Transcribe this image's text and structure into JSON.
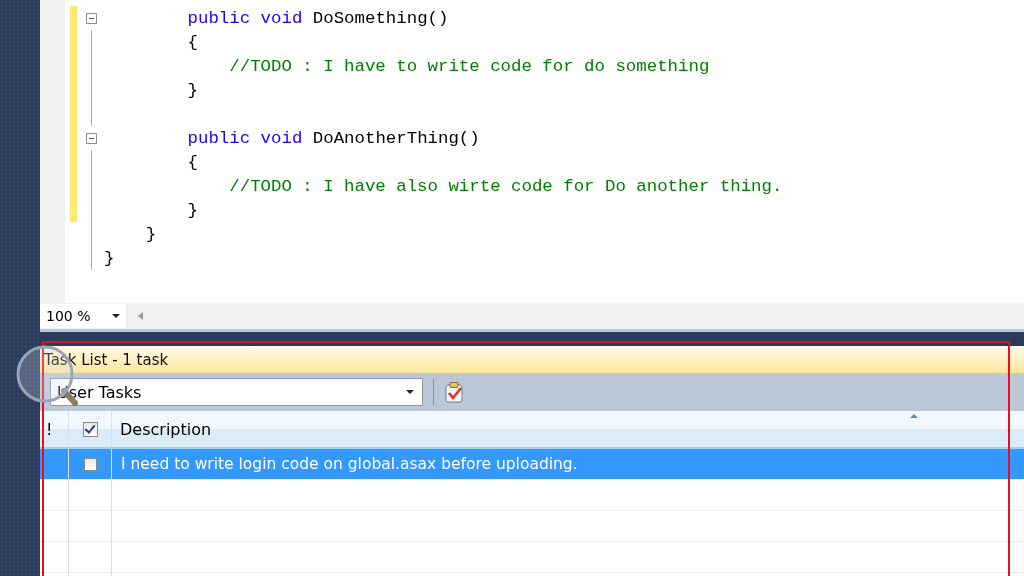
{
  "editor": {
    "code": [
      {
        "kind": "group",
        "children": [
          {
            "kind": "group",
            "changed": true,
            "children": [
              {
                "kind": "code",
                "fold": true,
                "tokens": [
                  {
                    "kind": "keyword",
                    "text": "public void"
                  },
                  {
                    "kind": "plain",
                    "text": " DoSomething()"
                  }
                ]
              },
              {
                "kind": "code",
                "fold": false,
                "tokens": [
                  {
                    "kind": "plain",
                    "text": "{"
                  }
                ]
              },
              {
                "kind": "group",
                "children": [
                  {
                    "kind": "code",
                    "fold": false,
                    "tokens": [
                      {
                        "kind": "comment",
                        "text": "//TODO : I have to write code for do something"
                      }
                    ]
                  }
                ]
              },
              {
                "kind": "code",
                "fold": false,
                "tokens": [
                  {
                    "kind": "plain",
                    "text": "}"
                  }
                ]
              },
              {
                "kind": "blank"
              },
              {
                "kind": "code",
                "fold": true,
                "tokens": [
                  {
                    "kind": "keyword",
                    "text": "public void"
                  },
                  {
                    "kind": "plain",
                    "text": " DoAnotherThing()"
                  }
                ]
              },
              {
                "kind": "code",
                "fold": false,
                "tokens": [
                  {
                    "kind": "plain",
                    "text": "{"
                  }
                ]
              },
              {
                "kind": "group",
                "children": [
                  {
                    "kind": "code",
                    "fold": false,
                    "tokens": [
                      {
                        "kind": "comment",
                        "text": "//TODO : I have also wirte code for Do another thing."
                      }
                    ]
                  }
                ]
              },
              {
                "kind": "code",
                "fold": false,
                "tokens": [
                  {
                    "kind": "plain",
                    "text": "}"
                  }
                ]
              }
            ]
          },
          {
            "kind": "code",
            "fold": false,
            "tokens": [
              {
                "kind": "plain",
                "text": "}"
              }
            ]
          }
        ]
      },
      {
        "kind": "code",
        "fold": false,
        "tokens": [
          {
            "kind": "plain",
            "text": "}"
          }
        ]
      }
    ],
    "zoom": "100 %"
  },
  "task_list": {
    "title": "Task List - 1 task",
    "filter": "User Tasks",
    "columns": [
      "!",
      "Description"
    ],
    "header_checked": true,
    "rows": [
      {
        "description": "I need to write login code on global.asax before uploading.",
        "checked": false,
        "selected": true
      }
    ]
  }
}
